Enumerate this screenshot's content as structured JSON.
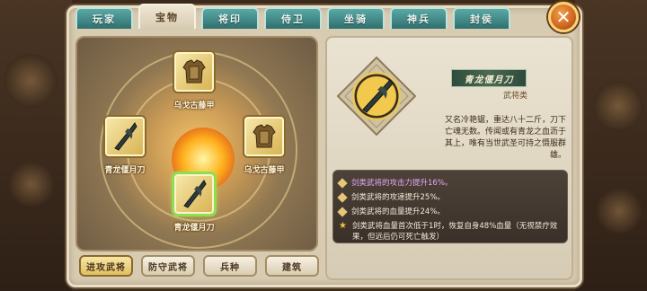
{
  "tabs": [
    {
      "label": "玩家",
      "active": false
    },
    {
      "label": "宝物",
      "active": true
    },
    {
      "label": "将印",
      "active": false
    },
    {
      "label": "侍卫",
      "active": false
    },
    {
      "label": "坐骑",
      "active": false
    },
    {
      "label": "神兵",
      "active": false
    },
    {
      "label": "封侯",
      "active": false
    }
  ],
  "close_icon": "close-x-icon",
  "slots": [
    {
      "name": "乌戈古藤甲",
      "icon": "armor-icon"
    },
    {
      "name": "青龙偃月刀",
      "icon": "blade-icon"
    },
    {
      "name": "乌戈古藤甲",
      "icon": "armor-icon"
    },
    {
      "name": "青龙偃月刀",
      "icon": "blade-icon",
      "selected": true
    }
  ],
  "bottom_buttons": [
    {
      "label": "进攻武将",
      "active": true
    },
    {
      "label": "防守武将",
      "active": false
    },
    {
      "label": "兵种",
      "active": false
    },
    {
      "label": "建筑",
      "active": false
    }
  ],
  "detail": {
    "item_name": "青龙偃月刀",
    "category": "武将类",
    "description": "又名冷艳锯，重达八十二斤，刀下亡魂无数。传闻或有青龙之血沥于其上，唯有当世武圣可持之慑服群雄。",
    "effects": [
      {
        "text": "剑类武将的攻击力提升16%。",
        "icon": "diamond-icon"
      },
      {
        "text": "剑类武将的攻速提升25%。",
        "icon": "diamond-icon"
      },
      {
        "text": "剑类武将的血量提升24%。",
        "icon": "diamond-icon"
      },
      {
        "text": "剑类武将血量首次低于1时，恢复自身48%血量（无视禁疗效果，但远后仍可死亡触发）",
        "icon": "star-icon"
      }
    ]
  },
  "colors": {
    "tab_inactive": "#3a8a86",
    "tab_active": "#efe6d3",
    "selected_glow": "#8dde52",
    "close_orange": "#d0641f"
  }
}
